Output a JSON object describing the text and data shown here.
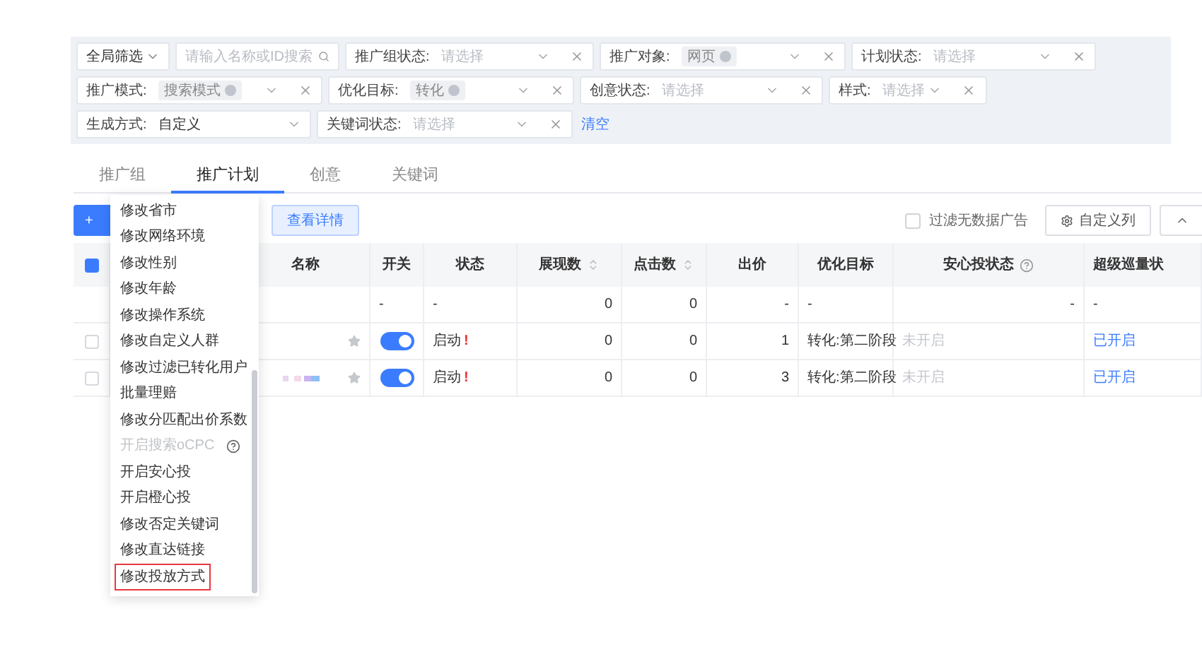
{
  "filters": [
    [
      {
        "kind": "menu",
        "value": "全局筛选"
      },
      {
        "kind": "search",
        "placeholder": "请输入名称或ID搜索"
      },
      {
        "kind": "select",
        "label": "推广组状态:",
        "placeholder": "请选择",
        "clearable": true
      },
      {
        "kind": "select",
        "label": "推广对象:",
        "tags": [
          "网页"
        ],
        "clearable": true
      },
      {
        "kind": "select",
        "label": "计划状态:",
        "placeholder": "请选择",
        "clearable": true
      }
    ],
    [
      {
        "kind": "select",
        "label": "推广模式:",
        "tags": [
          "搜索模式"
        ],
        "clearable": true
      },
      {
        "kind": "select",
        "label": "优化目标:",
        "tags": [
          "转化"
        ],
        "clearable": true
      },
      {
        "kind": "select",
        "label": "创意状态:",
        "placeholder": "请选择",
        "clearable": true
      },
      {
        "kind": "compact",
        "label": "样式:",
        "placeholder": "请选择",
        "clearable": true
      }
    ],
    [
      {
        "kind": "select",
        "label": "生成方式:",
        "value": "自定义",
        "clearable": false
      },
      {
        "kind": "select",
        "label": "关键词状态:",
        "placeholder": "请选择",
        "clearable": true
      },
      {
        "kind": "link",
        "value": "清空"
      }
    ]
  ],
  "tabs": [
    {
      "label": "推广组",
      "selected": false
    },
    {
      "label": "推广计划",
      "selected": true
    },
    {
      "label": "创意",
      "selected": false
    },
    {
      "label": "关键词",
      "selected": false
    }
  ],
  "toolbar": {
    "add_button": "+",
    "details_button": "查看详情",
    "filter_checkbox": {
      "label": "过滤无数据广告",
      "checked": false
    },
    "columns_button": "自定义列"
  },
  "table": {
    "header_checked": true,
    "columns": [
      {
        "label": "名称",
        "sortable": false,
        "help": false
      },
      {
        "label": "开关",
        "sortable": false,
        "help": false
      },
      {
        "label": "状态",
        "sortable": false,
        "help": false
      },
      {
        "label": "展现数",
        "sortable": true,
        "help": false
      },
      {
        "label": "点击数",
        "sortable": true,
        "help": false
      },
      {
        "label": "出价",
        "sortable": false,
        "help": false
      },
      {
        "label": "优化目标",
        "sortable": false,
        "help": false
      },
      {
        "label": "安心投状态",
        "sortable": false,
        "help": true
      },
      {
        "label": "超级巡量状",
        "sortable": false,
        "help": false
      }
    ],
    "rows": [
      {
        "kind": "summary",
        "toggle": "-",
        "status": "-",
        "impressions": "0",
        "clicks": "0",
        "bid": "-",
        "goal": "-",
        "safe": "-",
        "super": "-"
      },
      {
        "kind": "plan",
        "checked": false,
        "on": true,
        "status": "启动",
        "alert": "!",
        "impressions": "0",
        "clicks": "0",
        "bid": "1",
        "goal": "转化:第二阶段",
        "safe": "未开启",
        "super": "已开启",
        "redacted_name": false
      },
      {
        "kind": "plan",
        "checked": false,
        "on": true,
        "status": "启动",
        "alert": "!",
        "impressions": "0",
        "clicks": "0",
        "bid": "3",
        "goal": "转化:第二阶段",
        "safe": "未开启",
        "super": "已开启",
        "redacted_name": true
      }
    ]
  },
  "menu": {
    "items": [
      {
        "label": "修改省市",
        "disabled": false,
        "help": false,
        "highlighted": false
      },
      {
        "label": "修改网络环境",
        "disabled": false,
        "help": false,
        "highlighted": false
      },
      {
        "label": "修改性别",
        "disabled": false,
        "help": false,
        "highlighted": false
      },
      {
        "label": "修改年龄",
        "disabled": false,
        "help": false,
        "highlighted": false
      },
      {
        "label": "修改操作系统",
        "disabled": false,
        "help": false,
        "highlighted": false
      },
      {
        "label": "修改自定义人群",
        "disabled": false,
        "help": false,
        "highlighted": false
      },
      {
        "label": "修改过滤已转化用户",
        "disabled": false,
        "help": false,
        "highlighted": false
      },
      {
        "label": "批量理赔",
        "disabled": false,
        "help": false,
        "highlighted": false
      },
      {
        "label": "修改分匹配出价系数",
        "disabled": false,
        "help": false,
        "highlighted": false
      },
      {
        "label": "开启搜索oCPC",
        "disabled": true,
        "help": true,
        "highlighted": false
      },
      {
        "label": "开启安心投",
        "disabled": false,
        "help": false,
        "highlighted": false
      },
      {
        "label": "开启橙心投",
        "disabled": false,
        "help": false,
        "highlighted": false
      },
      {
        "label": "修改否定关键词",
        "disabled": false,
        "help": false,
        "highlighted": false
      },
      {
        "label": "修改直达链接",
        "disabled": false,
        "help": false,
        "highlighted": false
      },
      {
        "label": "修改投放方式",
        "disabled": false,
        "help": false,
        "highlighted": true
      }
    ]
  }
}
